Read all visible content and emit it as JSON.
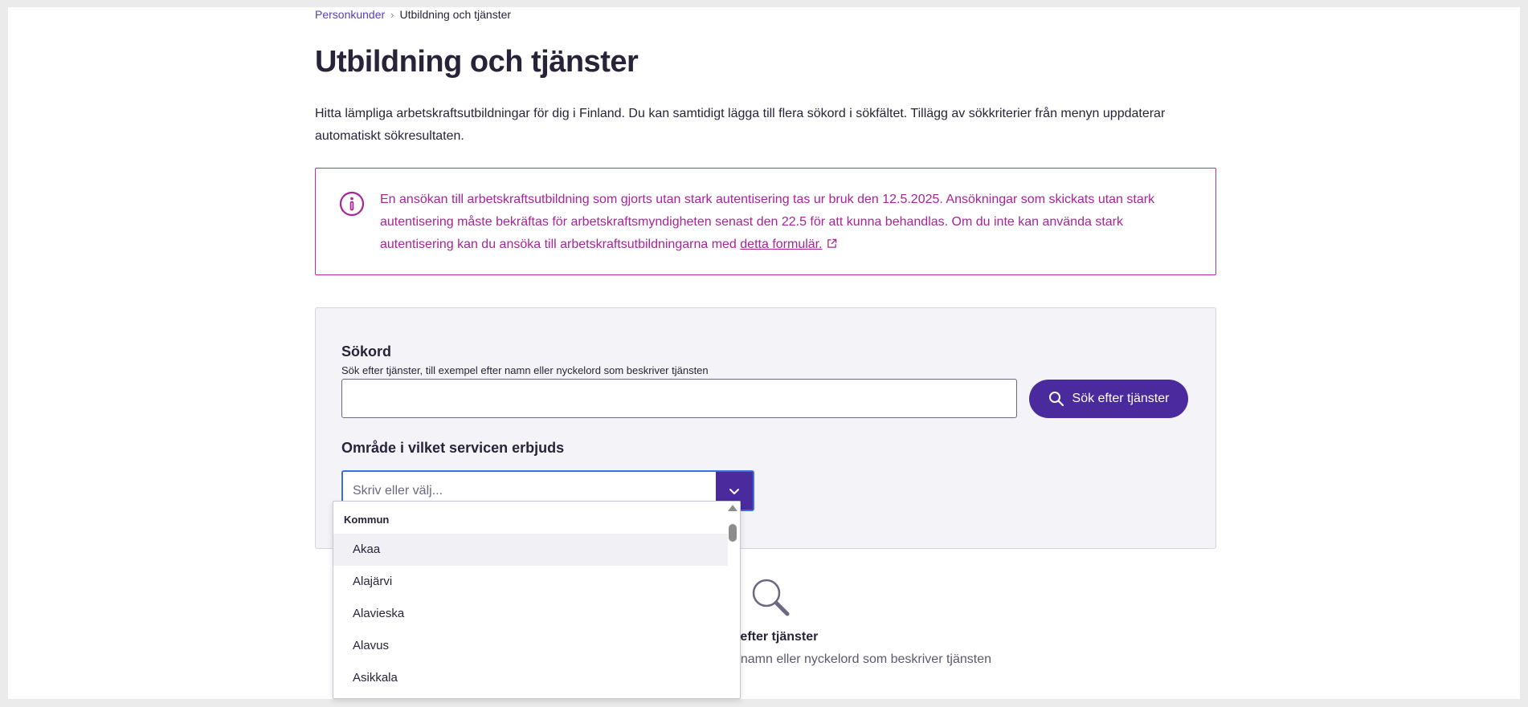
{
  "breadcrumb": {
    "parent": "Personkunder",
    "separator": "›",
    "current": "Utbildning och tjänster"
  },
  "page": {
    "title": "Utbildning och tjänster",
    "intro": "Hitta lämpliga arbetskraftsutbildningar för dig i Finland. Du kan samtidigt lägga till flera sökord i sökfältet. Tillägg av sökkriterier från menyn uppdaterar automatiskt sökresultaten."
  },
  "notice": {
    "icon": "info-circle-icon",
    "text": "En ansökan till arbetskraftsutbildning som gjorts utan stark autentisering tas ur bruk den 12.5.2025. Ansökningar som skickats utan stark autentisering måste bekräftas för arbetskraftsmyndigheten senast den 22.5 för att kunna behandlas. Om du inte kan använda stark autentisering kan du ansöka till arbetskraftsutbildningarna med",
    "link_text": "detta formulär.",
    "link_icon": "external-link-icon",
    "color": "#a8249a"
  },
  "search": {
    "keyword_label": "Sökord",
    "keyword_hint": "Sök efter tjänster, till exempel efter namn eller nyckelord som beskriver tjänsten",
    "keyword_value": "",
    "button_label": "Sök efter tjänster",
    "button_color": "#4a2a9c",
    "area_label": "Område i vilket servicen erbjuds",
    "area_placeholder": "Skriv eller välj..."
  },
  "dropdown": {
    "group_label": "Kommun",
    "options": [
      "Akaa",
      "Alajärvi",
      "Alavieska",
      "Alavus",
      "Asikkala"
    ],
    "highlighted_index": 0
  },
  "empty_state": {
    "icon": "search-icon",
    "title": "Sök efter tjänster",
    "text": "Sök efter tjänster, till exempel efter namn eller nyckelord som beskriver tjänsten"
  }
}
